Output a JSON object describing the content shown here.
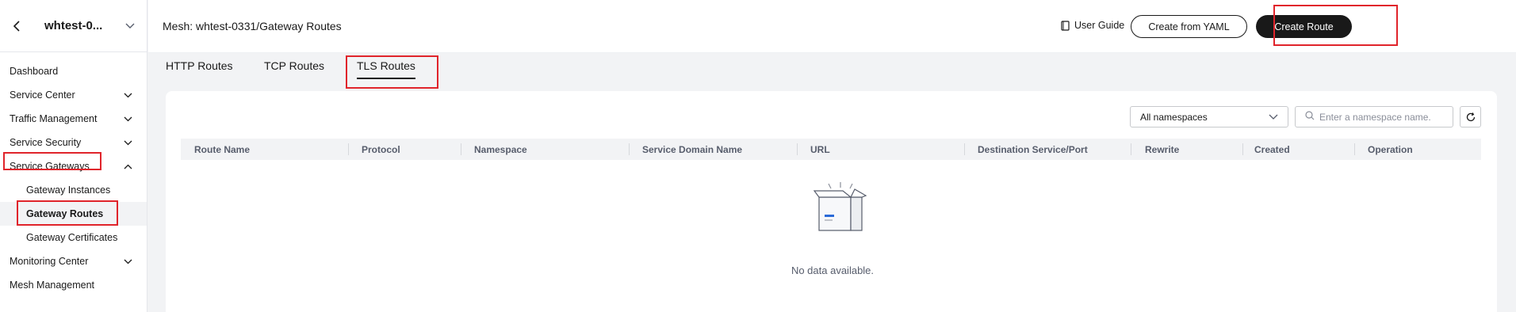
{
  "sidebar": {
    "title": "whtest-0...",
    "items": [
      {
        "label": "Dashboard",
        "chevron": ""
      },
      {
        "label": "Service Center",
        "chevron": "down"
      },
      {
        "label": "Traffic Management",
        "chevron": "down"
      },
      {
        "label": "Service Security",
        "chevron": "down"
      },
      {
        "label": "Service Gateways",
        "chevron": "up"
      },
      {
        "label": "Gateway Instances",
        "chevron": ""
      },
      {
        "label": "Gateway Routes",
        "chevron": ""
      },
      {
        "label": "Gateway Certificates",
        "chevron": ""
      },
      {
        "label": "Monitoring Center",
        "chevron": "down"
      },
      {
        "label": "Mesh Management",
        "chevron": ""
      }
    ]
  },
  "header": {
    "breadcrumb": "Mesh: whtest-0331/Gateway Routes",
    "user_guide": "User Guide",
    "create_yaml": "Create from YAML",
    "create_route": "Create Route"
  },
  "tabs": [
    "HTTP Routes",
    "TCP Routes",
    "TLS Routes"
  ],
  "active_tab": "TLS Routes",
  "filters": {
    "namespace_select": "All namespaces",
    "search_placeholder": "Enter a namespace name."
  },
  "table": {
    "columns": [
      "Route Name",
      "Protocol",
      "Namespace",
      "Service Domain Name",
      "URL",
      "Destination Service/Port",
      "Rewrite",
      "Created",
      "Operation"
    ],
    "empty_text": "No data available."
  },
  "colors": {
    "highlight": "#e0242b",
    "primary_dark": "#191919",
    "empty_icon_blue": "#2a6ad8"
  }
}
